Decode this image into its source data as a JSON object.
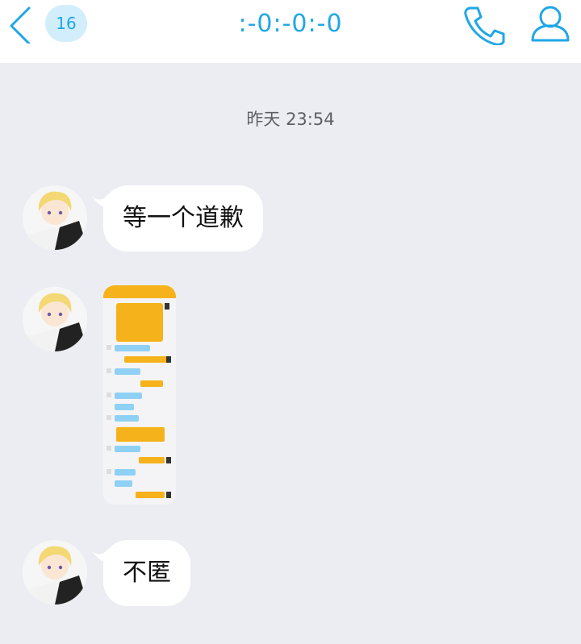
{
  "header": {
    "back_icon": "chevron-left-icon",
    "unread_count": "16",
    "title": ":-0:-0:-0",
    "call_icon": "phone-icon",
    "profile_icon": "person-icon",
    "accent_color": "#1fa7e6"
  },
  "chat": {
    "timestamp": "昨天 23:54",
    "messages": [
      {
        "type": "text",
        "text": "等一个道歉"
      },
      {
        "type": "image"
      },
      {
        "type": "text",
        "text": "不匿"
      }
    ]
  }
}
